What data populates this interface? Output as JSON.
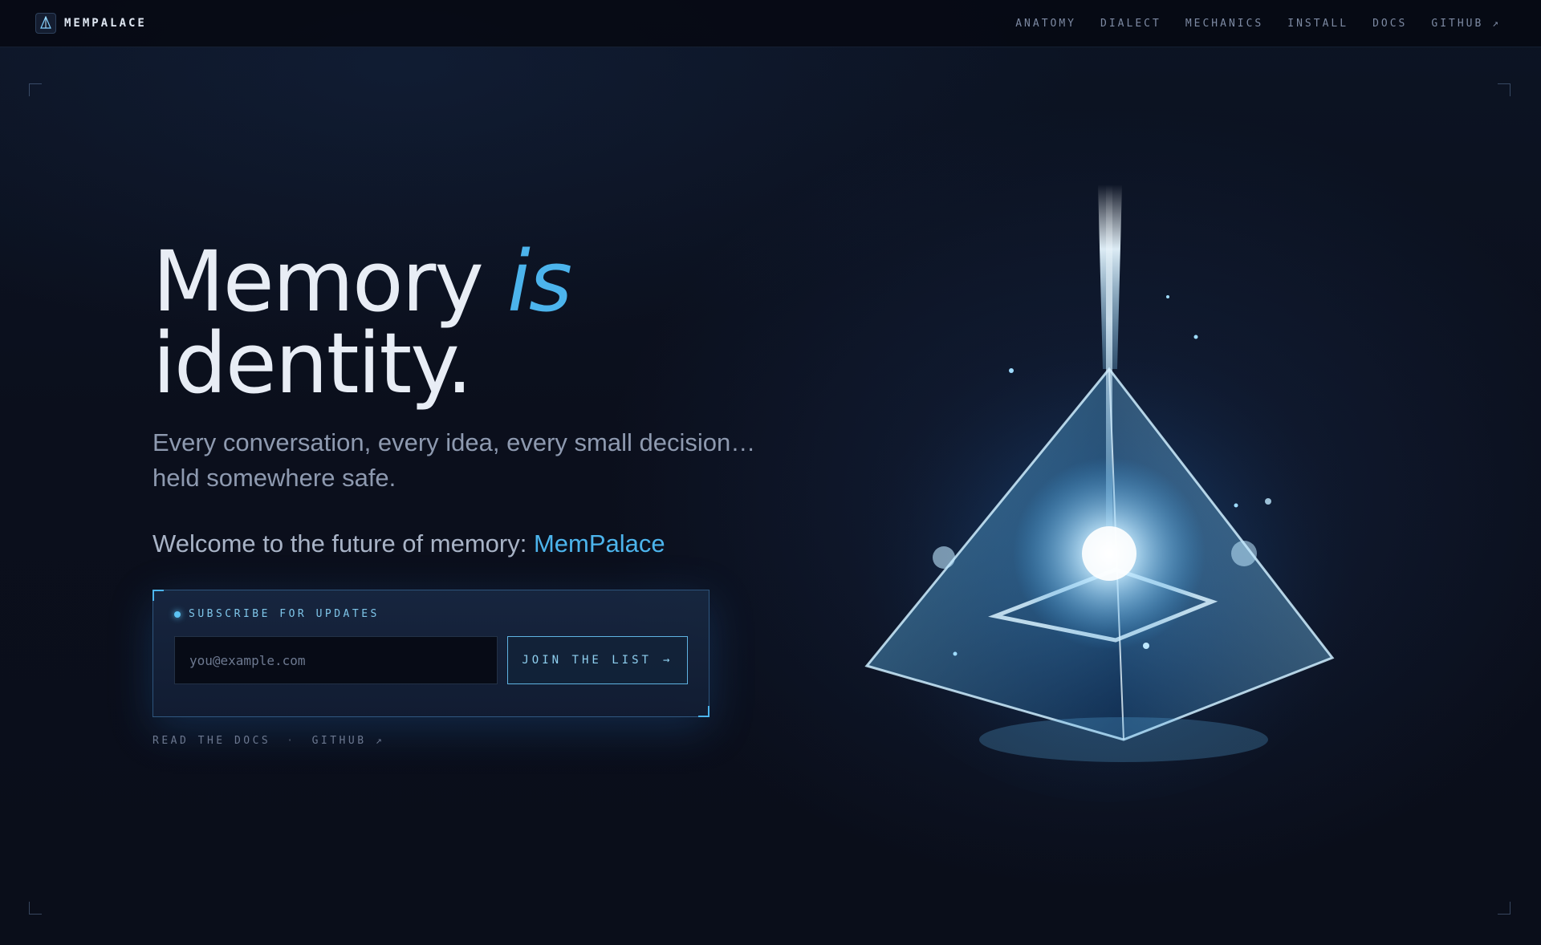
{
  "nav": {
    "brand": "MEMPALACE",
    "links": [
      {
        "label": "ANATOMY"
      },
      {
        "label": "DIALECT"
      },
      {
        "label": "MECHANICS"
      },
      {
        "label": "INSTALL"
      },
      {
        "label": "DOCS"
      },
      {
        "label": "GITHUB ↗"
      }
    ]
  },
  "hero": {
    "headline_part1": "Memory",
    "headline_accent": "is",
    "headline_part2": "identity.",
    "subtitle_line1": "Every conversation, every idea, every small decision…",
    "subtitle_line2": "held somewhere safe.",
    "welcome_text": "Welcome to the future of memory:",
    "welcome_brand": "MemPalace"
  },
  "subscribe": {
    "label": "SUBSCRIBE FOR UPDATES",
    "email_placeholder": "you@example.com",
    "button_label": "JOIN THE LIST",
    "button_arrow": "→"
  },
  "footer_links": {
    "docs": "READ THE DOCS",
    "separator": "·",
    "github": "GITHUB ↗"
  },
  "colors": {
    "accent": "#4cb4ec",
    "background": "#0b0f1c"
  }
}
